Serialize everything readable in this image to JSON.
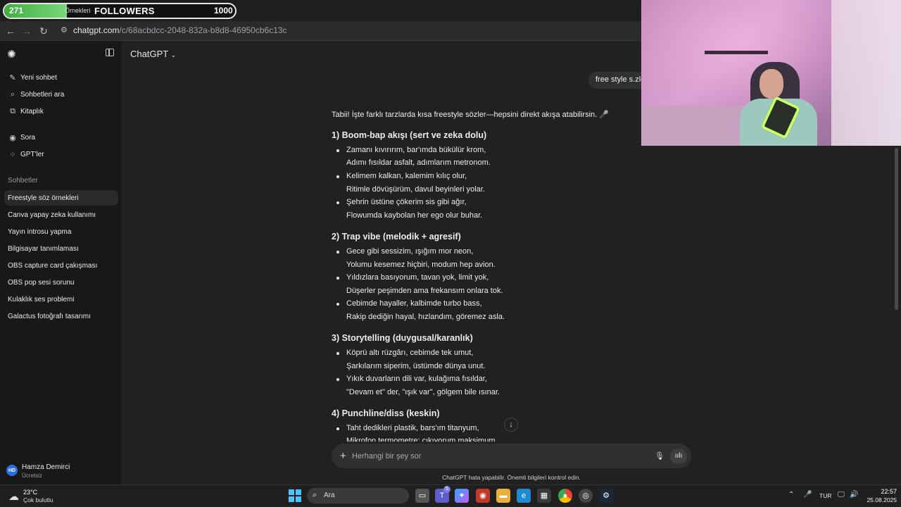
{
  "browser": {
    "url_host": "chatgpt.com",
    "url_path": "/c/68acbdcc-2048-832a-b8d8-46950cb6c13c"
  },
  "followers_overlay": {
    "count": "271",
    "scroll_text": "Örnekleri",
    "label": "FOLLOWERS",
    "goal": "1000",
    "progress_fraction": 0.271
  },
  "sidebar": {
    "top_items": [
      {
        "label": "Yeni sohbet",
        "icon": "new-chat-icon"
      },
      {
        "label": "Sohbetleri ara",
        "icon": "search-icon"
      },
      {
        "label": "Kitaplık",
        "icon": "library-icon"
      },
      {
        "label": "Sora",
        "icon": "play-icon"
      },
      {
        "label": "GPT'ler",
        "icon": "grid-icon"
      }
    ],
    "section_label": "Sohbetler",
    "chats": [
      "Freestyle söz örnekleri",
      "Canva yapay zeka kullanımı",
      "Yayın introsu yapma",
      "Bilgisayar tanımlaması",
      "OBS capture card çakışması",
      "OBS pop sesi sorunu",
      "Kulaklık ses problemi",
      "Galactus fotoğrafı tasarımı"
    ],
    "user": {
      "initials": "HD",
      "name": "Hamza Demirci",
      "plan": "Ücretsiz"
    }
  },
  "header": {
    "model": "ChatGPT"
  },
  "user_message": "free style s.zle",
  "response": {
    "intro": "Tabii! İşte farklı tarzlarda kısa freestyle sözler—hepsini direkt akışa atabilirsin. 🎤",
    "sections": [
      {
        "heading": "1) Boom-bap akışı (sert ve zeka dolu)",
        "verses": [
          [
            "Zamanı kıvırırım, bar'ımda bükülür krom,",
            "Adımı fısıldar asfalt, adımlarım metronom."
          ],
          [
            "Kelimem kalkan, kalemim kılıç olur,",
            "Ritimle dövüşürüm, davul beyinleri yolar."
          ],
          [
            "Şehrin üstüne çökerim sis gibi ağır,",
            "Flowumda kaybolan her ego olur buhar."
          ]
        ]
      },
      {
        "heading": "2) Trap vibe (melodik + agresif)",
        "verses": [
          [
            "Gece gibi sessizim, ışığım mor neon,",
            "Yolumu kesemez hiçbiri, modum hep avion."
          ],
          [
            "Yıldızlara basıyorum, tavan yok, limit yok,",
            "Düşerler peşimden ama frekansım onlara tok."
          ],
          [
            "Cebimde hayaller, kalbimde turbo bass,",
            "Rakip dediğin hayal, hızlandım, göremez asla."
          ]
        ]
      },
      {
        "heading": "3) Storytelling (duygusal/karanlık)",
        "verses": [
          [
            "Köprü altı rüzgârı, cebimde tek umut,",
            "Şarkılarım siperim, üstümde dünya unut."
          ],
          [
            "Yıkık duvarların dili var, kulağıma fısıldar,",
            "\"Devam et\" der, \"ışık var\", gölgem bile ısınar."
          ]
        ]
      },
      {
        "heading": "4) Punchline/diss (keskin)",
        "verses": [
          [
            "Taht dedikleri plastik, bars'ım titanyum,",
            "Mikrofon termometre; çıkıyorum maksimum."
          ]
        ]
      }
    ]
  },
  "composer": {
    "placeholder": "Herhangi bir şey sor",
    "plus": "+"
  },
  "disclaimer": "ChatGPT hata yapabilir. Önemli bilgileri kontrol edin.",
  "taskbar": {
    "weather_temp": "23°C",
    "weather_desc": "Çok bulutlu",
    "search_text": "Ara",
    "teams_badge": "5",
    "lang": "TUR",
    "time": "22:57",
    "date": "25.08.2025"
  },
  "colors": {
    "accent_start": "#4cc2ff",
    "followers_fill": "#3fae3f",
    "avatar": "#2b6de0"
  }
}
